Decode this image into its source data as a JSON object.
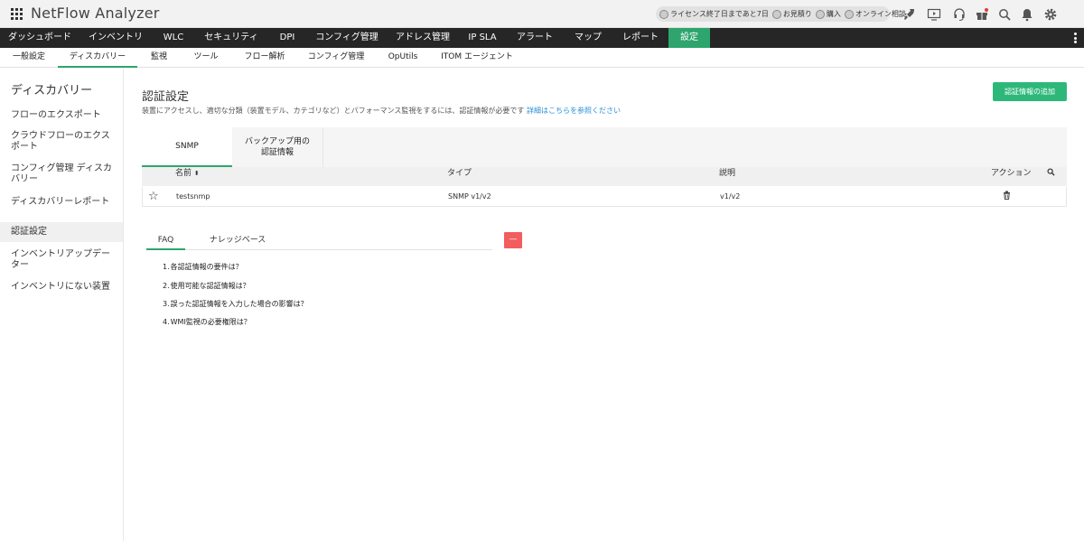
{
  "app": {
    "title": "NetFlow Analyzer"
  },
  "header": {
    "pills": [
      {
        "label": "ライセンス終了日まであと7日",
        "icon": "license-icon"
      },
      {
        "label": "お見積り",
        "icon": "quote-icon"
      },
      {
        "label": "購入",
        "icon": "purchase-icon"
      },
      {
        "label": "オンライン相談",
        "icon": "consult-icon"
      }
    ],
    "icons": [
      "rocket-icon",
      "video-icon",
      "headset-icon",
      "gift-icon",
      "search-icon",
      "bell-icon",
      "gear-icon"
    ]
  },
  "mainnav": {
    "items": [
      {
        "label": "ダッシュボード"
      },
      {
        "label": "インベントリ"
      },
      {
        "label": "WLC"
      },
      {
        "label": "セキュリティ"
      },
      {
        "label": "DPI"
      },
      {
        "label": "コンフィグ管理"
      },
      {
        "label": "アドレス管理"
      },
      {
        "label": "IP SLA"
      },
      {
        "label": "アラート"
      },
      {
        "label": "マップ"
      },
      {
        "label": "レポート"
      },
      {
        "label": "設定",
        "active": true
      }
    ]
  },
  "subnav": {
    "items": [
      {
        "label": "一般設定"
      },
      {
        "label": "ディスカバリー",
        "active": true
      },
      {
        "label": "監視"
      },
      {
        "label": "ツール"
      },
      {
        "label": "フロー解析"
      },
      {
        "label": "コンフィグ管理"
      },
      {
        "label": "OpUtils"
      },
      {
        "label": "ITOM エージェント"
      }
    ]
  },
  "sidebar": {
    "title": "ディスカバリー",
    "items": [
      {
        "label": "フローのエクスポート"
      },
      {
        "label": "クラウドフローのエクスポート"
      },
      {
        "label": "コンフィグ管理 ディスカバリー"
      },
      {
        "label": "ディスカバリーレポート"
      },
      {
        "label": "認証設定",
        "active": true
      },
      {
        "label": "インベントリアップデーター"
      },
      {
        "label": "インベントリにない装置"
      }
    ]
  },
  "main": {
    "title": "認証設定",
    "description": "装置にアクセスし、適切な分類（装置モデル、カテゴリなど）とパフォーマンス監視をするには、認証情報が必要です",
    "description_link": "詳細はこちらを参照ください",
    "add_button": "認証情報の追加",
    "tabs": [
      {
        "label": "SNMP",
        "active": true
      },
      {
        "label": "バックアップ用の認証情報"
      }
    ],
    "table": {
      "columns": {
        "name": "名前",
        "type": "タイプ",
        "desc": "説明",
        "action": "アクション"
      },
      "rows": [
        {
          "name": "testsnmp",
          "type": "SNMP v1/v2",
          "desc": "v1/v2"
        }
      ]
    },
    "faq": {
      "tabs": [
        {
          "label": "FAQ",
          "active": true
        },
        {
          "label": "ナレッジベース"
        }
      ],
      "collapse_label": "—",
      "items": [
        {
          "num": "1.",
          "text": "各認証情報の要件は？"
        },
        {
          "num": "2.",
          "text": "使用可能な認証情報は？"
        },
        {
          "num": "3.",
          "text": "誤った認証情報を入力した場合の影響は？"
        },
        {
          "num": "4.",
          "text": "WMI監視の必要権限は？"
        }
      ]
    }
  }
}
